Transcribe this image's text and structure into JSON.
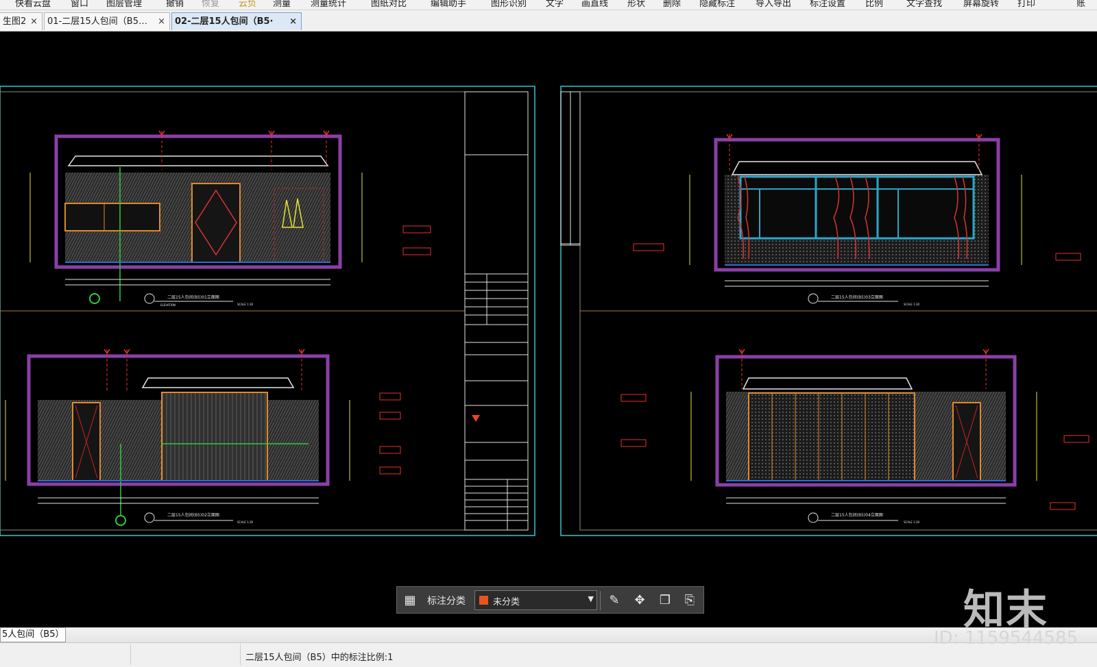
{
  "menu": {
    "items": [
      "快看云盘",
      "窗口",
      "图层管理",
      "撤销",
      "恢复",
      "云负",
      "测量",
      "测量统计",
      "图纸对比",
      "编辑助手",
      "图形识别",
      "文字",
      "画直线",
      "形状",
      "删除",
      "隐藏标注",
      "导入导出",
      "标注设置",
      "比例",
      "文字查找",
      "屏幕旋转",
      "打印",
      "账"
    ]
  },
  "tabs": [
    {
      "label": "生图2",
      "close": "×"
    },
    {
      "label": "01-二层15人包间（B5…",
      "close": "×"
    },
    {
      "label": "02-二层15人包间（B5·",
      "close": "×"
    }
  ],
  "drawing": {
    "title_1": "二层15人包间(B5)01立面图",
    "title_2": "二层15人包间(B5)02立面图",
    "title_3": "二层15人包间(B5)03立面图",
    "title_4": "二层15人包间(B5)04立面图",
    "elev_label": "ELEVATION",
    "scale": "SCALE 1:30"
  },
  "toolbar": {
    "label": "标注分类",
    "select_value": "未分类",
    "swatch_color": "#e8541e",
    "icons": [
      "grid-icon",
      "edit-icon",
      "move-icon",
      "copy-icon",
      "paste-icon"
    ]
  },
  "sheet_tab": {
    "label": "5人包间（B5）"
  },
  "status": {
    "text": "二层15人包间（B5）中的标注比例:1"
  },
  "watermark": {
    "brand": "知末",
    "id": "ID: 1159544585"
  }
}
